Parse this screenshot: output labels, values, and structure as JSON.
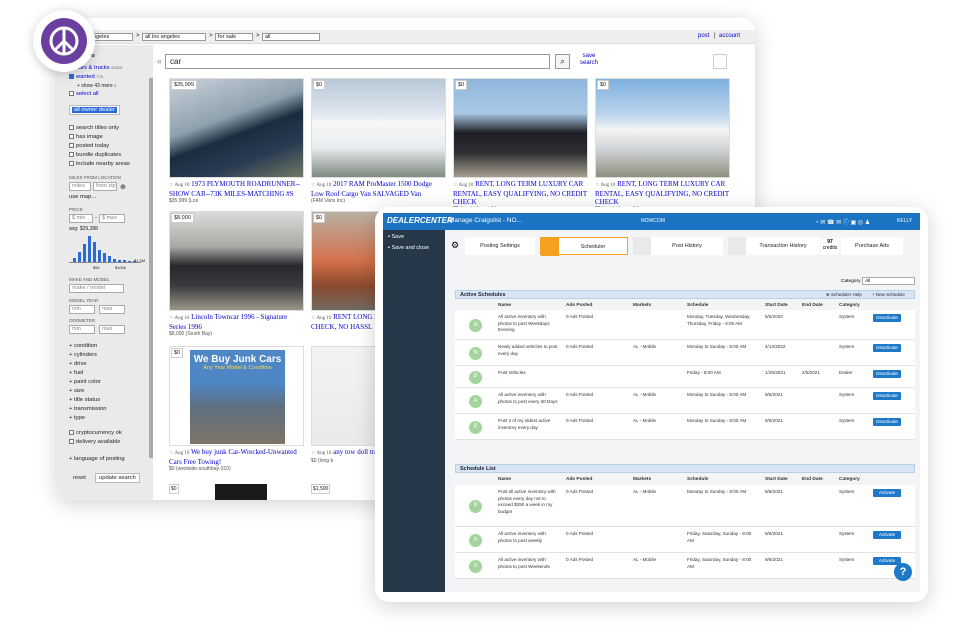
{
  "cl": {
    "top": {
      "sel1": "angeles",
      "sel2": "all los angeles",
      "sel3": "for sale",
      "sel4": "all",
      "post": "post",
      "account": "account"
    },
    "side": {
      "cat": "ro",
      "cars": "cars & trucks",
      "cars_count": "22629",
      "wanted": "wanted",
      "wanted_count": "776",
      "more": "+ show 43 more",
      "more_count": "0",
      "select_all": "select all",
      "owner_dealer": "all owner dealer",
      "opts": [
        "search titles only",
        "has image",
        "posted today",
        "bundle duplicates",
        "include nearby areas"
      ],
      "miles_label": "MILES FROM LOCATION",
      "miles_ph": "miles",
      "zip_ph": "from zip",
      "use_map": "use map...",
      "price_label": "PRICE",
      "min": "$ min",
      "max": "$ max",
      "avg": "avg: $29,288",
      "h_left": "$5k",
      "h_mid": "$100k",
      "h_right": "$1.3M",
      "make_label": "MAKE AND MODEL",
      "make_ph": "make / model",
      "year_label": "MODEL YEAR",
      "min2": "min",
      "max2": "max",
      "odo_label": "ODOMETER",
      "min3": "min",
      "max3": "max",
      "links": [
        "+ condition",
        "+ cylinders",
        "+ drive",
        "+ fuel",
        "+ paint color",
        "+ size",
        "+ title status",
        "+ transmission",
        "+ type"
      ],
      "crypto": "cryptocurrency ok",
      "delivery": "delivery available",
      "lang": "+ language of posting",
      "reset": "reset",
      "update": "update search"
    },
    "search": {
      "value": "car",
      "save": "save",
      "search": "search"
    },
    "listings": [
      {
        "price": "$35,999",
        "date": "Aug 10",
        "title": "1973 PLYMOUTH ROADRUNNER--SHOW CAR--73K MILES-MATCHING #S",
        "meta": "$35,999 (Los"
      },
      {
        "price": "$0",
        "date": "Aug 10",
        "title": "2017 RAM ProMaster 1500 Dodge Low Roof Cargo Van SALVAGED Van",
        "meta": "(FAM Vans Inc)"
      },
      {
        "price": "$0",
        "date": "Aug 10",
        "title": "RENT, LONG TERM LUXURY CAR RENTAL, EASY QUALIFYING, NO CREDIT CHECK",
        "meta": "$0 (westside-southbay-"
      },
      {
        "price": "$0",
        "date": "Aug 10",
        "title": "RENT, LONG TERM LUXURY CAR RENTAL, EASY QUALIFYING, NO CREDIT CHECK",
        "meta": "$0 (westside-southbay-"
      },
      {
        "price": "$8,000",
        "date": "Aug 10",
        "title": "Lincoln Towncar 1996 - Signature Series 1996",
        "meta": "$8,000 (South Bay)"
      },
      {
        "price": "$0",
        "date": "Aug 10",
        "title": "RENT LONG EASY CAR RENTAL CHECK, NO HASSL",
        "meta": ""
      },
      {
        "price": "$0",
        "date": "Aug 10",
        "title": "We buy junk Car-Wrecked-Unwanted Cars Free Towing!",
        "meta": "$0 (westside-southbay-310)",
        "ad1": "We Buy Junk Cars",
        "ad2": "Any Year Model & Condition"
      },
      {
        "price": "",
        "date": "Aug 10",
        "title": "any tow doll trailer or ?",
        "meta": "$0 (long b"
      }
    ],
    "bottom_prices": [
      "$0",
      "$1,500"
    ]
  },
  "dc": {
    "logo": "DEALERCENTER",
    "title": "Manage Craigslist - NO...",
    "brand": "NOWCOM",
    "user": "KELLY",
    "left": [
      "Save",
      "Save and close"
    ],
    "tabs": [
      "Posting Settings",
      "Scheduler",
      "Post History",
      "Transaction History",
      "Purchase Ads"
    ],
    "credits_num": "97",
    "credits": "credits",
    "cat_label": "Category",
    "cat_value": "All",
    "active_title": "Active Schedules",
    "help": "Scheduler Help",
    "new": "New Schedule",
    "headers": [
      "Name",
      "Ads Posted",
      "Markets",
      "Schedule",
      "Start Date",
      "End Date",
      "Category"
    ],
    "active": [
      {
        "av": "A",
        "name": "All active inventory with photos to post Weekdays Evening",
        "ads": "0 Ads Posted",
        "market": "",
        "sched": "Monday, Tuesday, Wednesday, Thursday, Friday - 6:00 AM",
        "start": "5/5/2020",
        "end": "",
        "cat": "System",
        "btn": "Deactivate"
      },
      {
        "av": "N",
        "name": "Newly added vehicles to post every day",
        "ads": "0 Ads Posted",
        "market": "AL - Mobile",
        "sched": "Monday to Sunday - 8:00 AM",
        "start": "4/13/2022",
        "end": "",
        "cat": "System",
        "btn": "Deactivate"
      },
      {
        "av": "P",
        "name": "Post Vehicles",
        "ads": "",
        "market": "",
        "sched": "Friday - 8:00 AM",
        "start": "1/29/2021",
        "end": "2/5/2021",
        "cat": "Dealer",
        "btn": "Deactivate"
      },
      {
        "av": "A",
        "name": "All active inventory with photos to post every 30 Days",
        "ads": "0 Ads Posted",
        "market": "AL - Mobile",
        "sched": "Monday to Sunday - 8:00 AM",
        "start": "9/6/2021",
        "end": "",
        "cat": "System",
        "btn": "Deactivate"
      },
      {
        "av": "P",
        "name": "Post 2 of my oldest active inventory every day",
        "ads": "0 Ads Posted",
        "market": "AL - Mobile",
        "sched": "Monday to Sunday - 8:00 AM",
        "start": "9/6/2021",
        "end": "",
        "cat": "System",
        "btn": "Deactivate"
      }
    ],
    "list_title": "Schedule List",
    "list": [
      {
        "av": "P",
        "name": "Post all active inventory with photos every day not to exceed $250 a week in my budget",
        "ads": "0 Ads Posted",
        "market": "AL - Mobile",
        "sched": "Monday to Sunday - 8:00 AM",
        "start": "9/6/2021",
        "end": "",
        "cat": "System",
        "btn": "Activate"
      },
      {
        "av": "A",
        "name": "All active inventory with photos to post weekly",
        "ads": "0 Ads Posted",
        "market": "",
        "sched": "Friday, Saturday, Sunday - 8:00 AM",
        "start": "9/6/2021",
        "end": "",
        "cat": "System",
        "btn": "Activate"
      },
      {
        "av": "A",
        "name": "All active inventory with photos to post Weekends",
        "ads": "0 Ads Posted",
        "market": "AL - Mobile",
        "sched": "Friday, Saturday, Sunday - 8:00 AM",
        "start": "9/6/2021",
        "end": "",
        "cat": "System",
        "btn": "Activate"
      }
    ],
    "help_btn": "?"
  }
}
